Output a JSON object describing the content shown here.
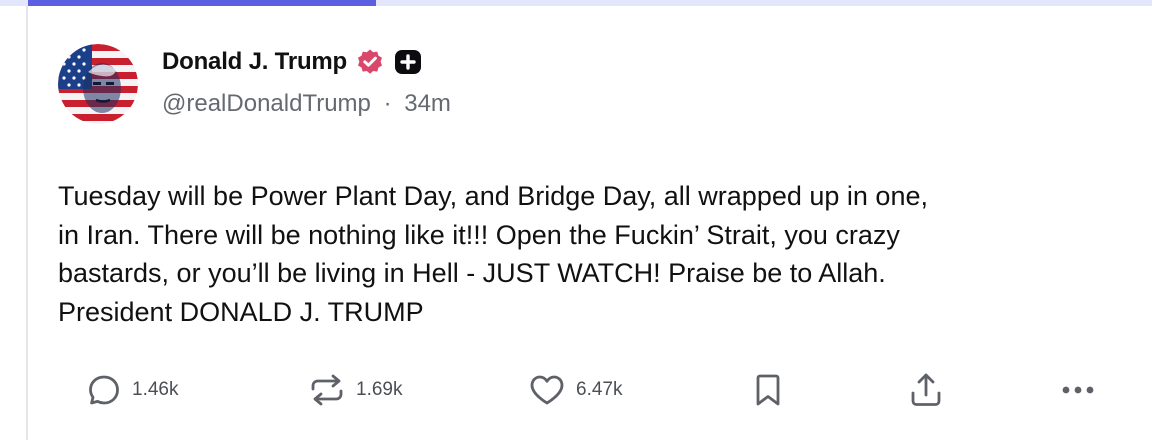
{
  "colors": {
    "accent": "#5c5fe2",
    "track": "#e4e7fb",
    "verified_badge": "#d9476b",
    "text": "#111111",
    "muted": "#666a70",
    "icon": "#5e6268"
  },
  "progress": {
    "fraction": 0.31
  },
  "post": {
    "author": {
      "display_name": "Donald J. Trump",
      "handle": "@realDonaldTrump",
      "separator": "·",
      "time": "34m",
      "avatar_icon": "avatar-flag-portrait",
      "verified_icon": "verified-badge-icon",
      "plus_icon": "plus-badge-icon"
    },
    "body_lines": [
      "Tuesday will be Power Plant Day, and Bridge Day, all wrapped up in one,",
      "in Iran. There will be nothing like it!!! Open the Fuckin’ Strait, you crazy",
      "bastards, or you’ll be living in Hell - JUST WATCH! Praise be to Allah.",
      "President DONALD J. TRUMP"
    ],
    "actions": {
      "reply": {
        "icon": "reply-icon",
        "count": "1.46k"
      },
      "retruth": {
        "icon": "repost-icon",
        "count": "1.69k"
      },
      "like": {
        "icon": "heart-icon",
        "count": "6.47k"
      },
      "bookmark": {
        "icon": "bookmark-icon"
      },
      "share": {
        "icon": "share-icon"
      },
      "more": {
        "icon": "more-icon"
      }
    }
  }
}
